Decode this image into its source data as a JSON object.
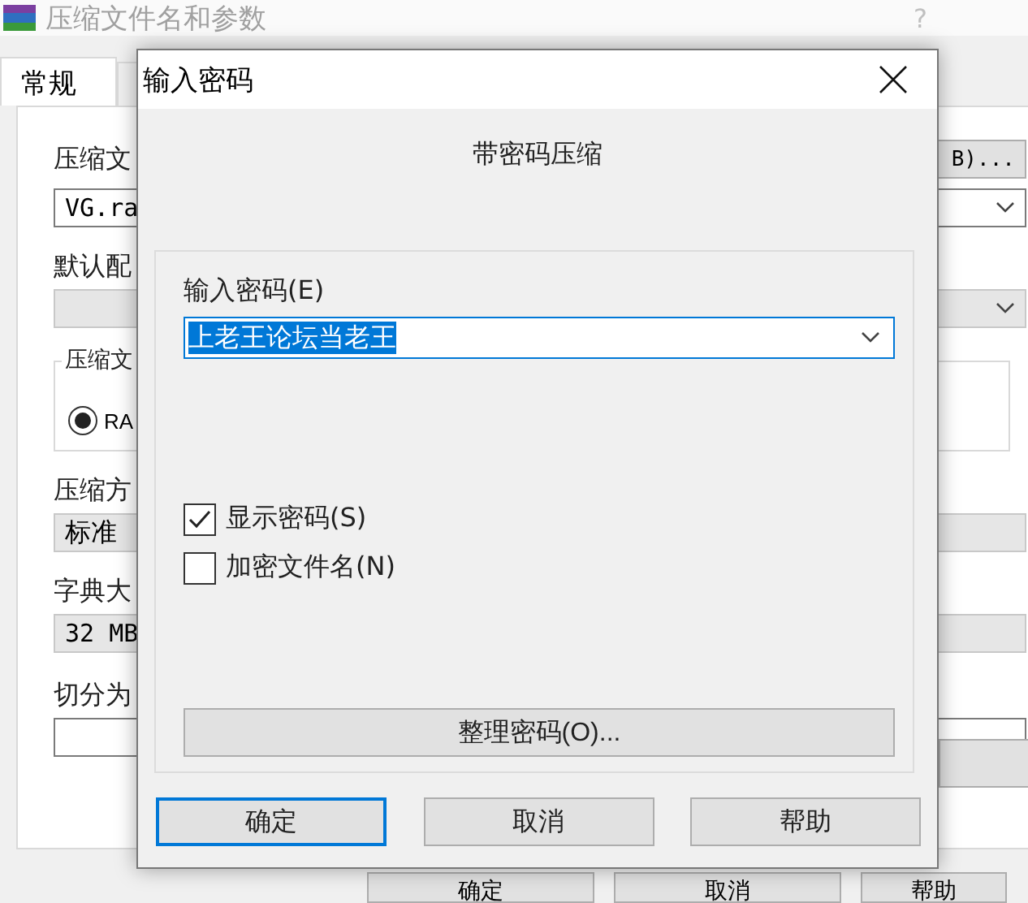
{
  "background_window": {
    "title": "压缩文件名和参数",
    "help": "?",
    "tabs": [
      {
        "label": "常规",
        "selected": true
      },
      {
        "selected": false
      }
    ],
    "archive_name_label": "压缩文",
    "browse_button": "B)...",
    "archive_name_value": "VG.ra",
    "profiles_label": "默认配",
    "format_group_label": "压缩文",
    "format_radio": {
      "label": "RA",
      "selected": true
    },
    "method_label": "压缩方",
    "method_value": "标准",
    "dictionary_label": "字典大",
    "dictionary_value": "32 MB",
    "split_label": "切分为",
    "buttons": [
      "确定",
      "取消",
      "帮助"
    ]
  },
  "dialog": {
    "title": "输入密码",
    "heading": "带密码压缩",
    "password_label": "输入密码(E)",
    "password_value": "上老王论坛当老王",
    "checkboxes": [
      {
        "label": "显示密码(S)",
        "checked": true
      },
      {
        "label": "加密文件名(N)",
        "checked": false
      }
    ],
    "organize_button": "整理密码(O)...",
    "buttons": [
      {
        "label": "确定",
        "focused": true
      },
      {
        "label": "取消",
        "focused": false
      },
      {
        "label": "帮助",
        "focused": false
      }
    ]
  }
}
